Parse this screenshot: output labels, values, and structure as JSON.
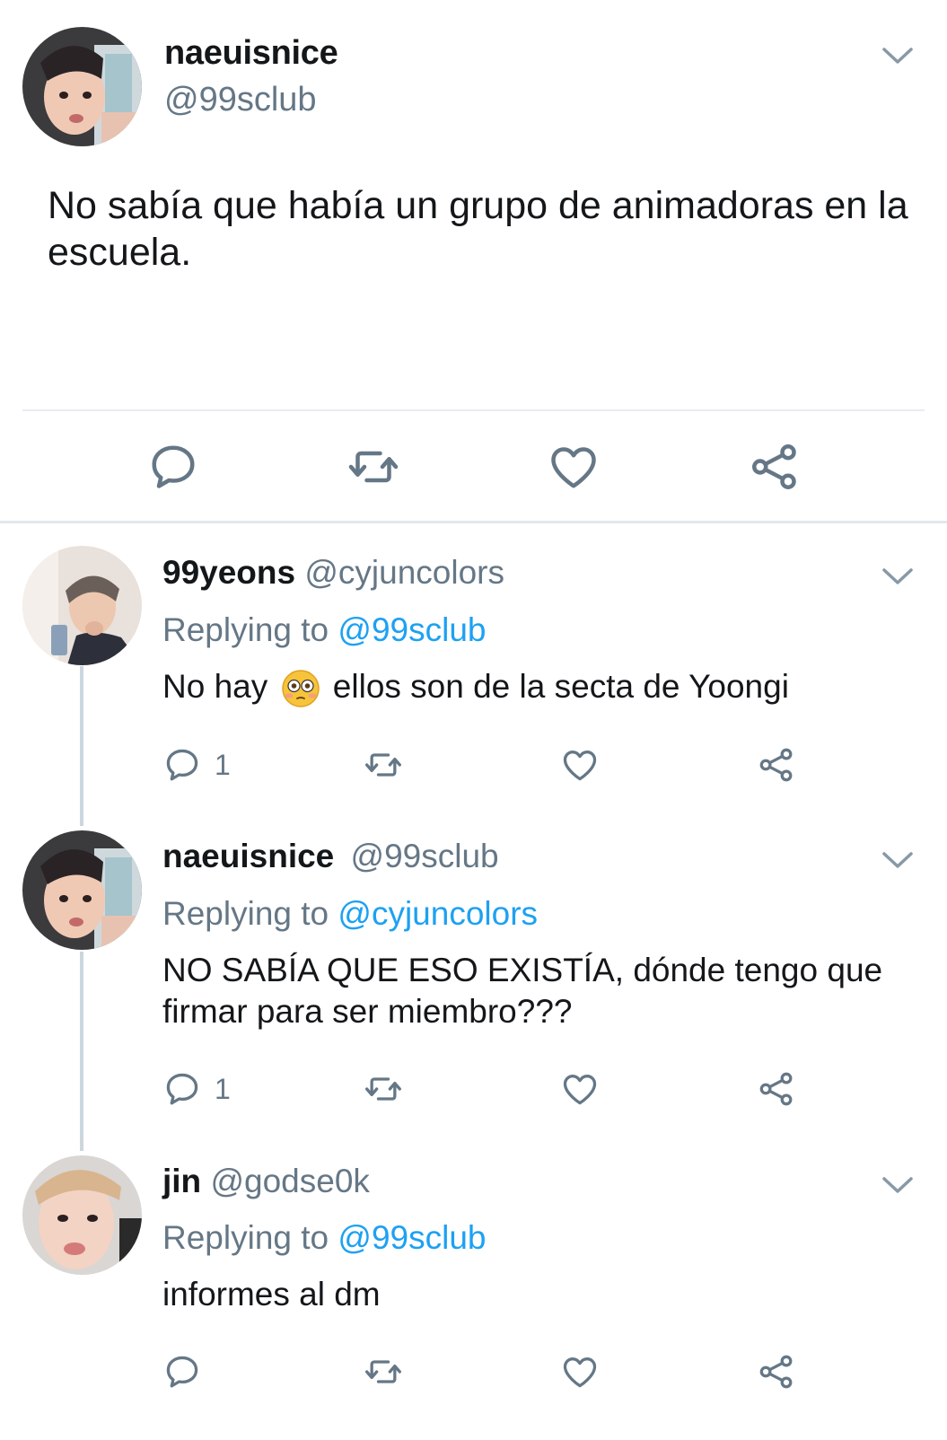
{
  "main_tweet": {
    "display_name": "naeuisnice",
    "handle": "@99sclub",
    "text": "No sabía que había un grupo de animadoras en la escuela."
  },
  "replies": [
    {
      "display_name": "99yeons",
      "handle": "@cyjuncolors",
      "replying_label": "Replying to",
      "replying_to": "@99sclub",
      "text_before": "No hay",
      "emoji": "flushed-face",
      "text_after": "ellos son de la secta de Yoongi",
      "reply_count": "1"
    },
    {
      "display_name": "naeuisnice",
      "handle": "@99sclub",
      "replying_label": "Replying to",
      "replying_to": "@cyjuncolors",
      "text": "NO SABÍA QUE ESO EXISTÍA,  dónde tengo que firmar para ser miembro???",
      "reply_count": "1"
    },
    {
      "display_name": "jin",
      "handle": "@godse0k",
      "replying_label": "Replying to",
      "replying_to": "@99sclub",
      "text": "informes al dm",
      "reply_count": ""
    }
  ],
  "icons": [
    "reply-icon",
    "retweet-icon",
    "like-icon",
    "share-icon",
    "chevron-down-icon",
    "avatar"
  ],
  "colors": {
    "link": "#1da1f2",
    "secondary_text": "#657786",
    "icon": "#657786",
    "divider": "#e6ecf0"
  }
}
